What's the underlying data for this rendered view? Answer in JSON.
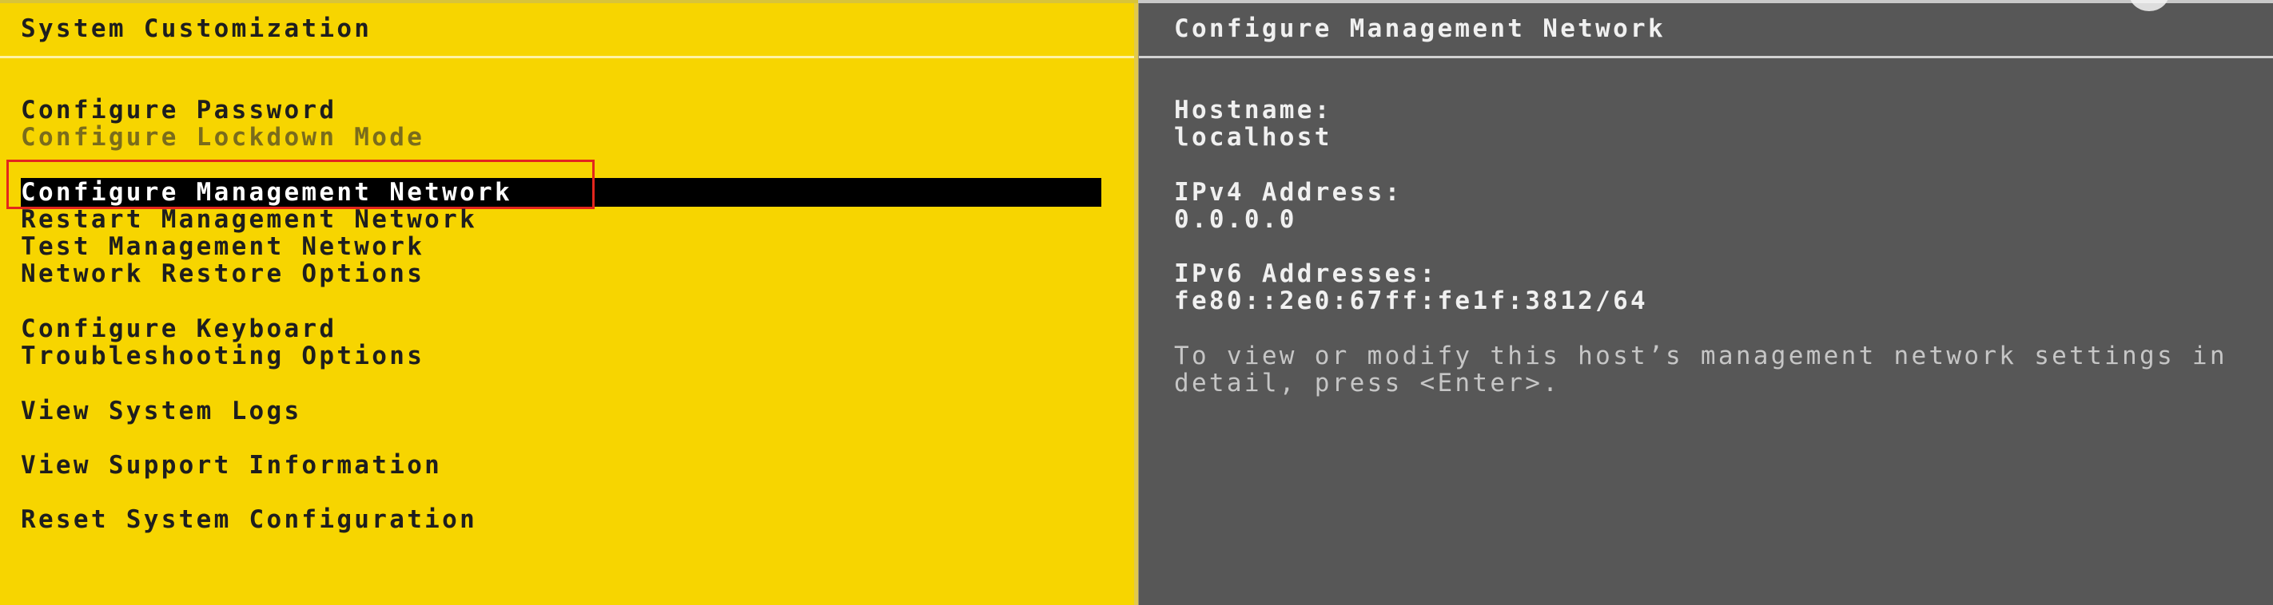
{
  "left_pane": {
    "title": "System Customization",
    "menu": [
      {
        "label": "Configure Password",
        "state": "normal"
      },
      {
        "label": "Configure Lockdown Mode",
        "state": "disabled"
      },
      {
        "label": "Configure Management Network",
        "state": "selected"
      },
      {
        "label": "Restart Management Network",
        "state": "normal"
      },
      {
        "label": "Test Management Network",
        "state": "normal"
      },
      {
        "label": "Network Restore Options",
        "state": "normal"
      },
      {
        "label": "Configure Keyboard",
        "state": "normal"
      },
      {
        "label": "Troubleshooting Options",
        "state": "normal"
      },
      {
        "label": "View System Logs",
        "state": "normal"
      },
      {
        "label": "View Support Information",
        "state": "normal"
      },
      {
        "label": "Reset System Configuration",
        "state": "normal"
      }
    ]
  },
  "right_pane": {
    "title": "Configure Management Network",
    "hostname_label": "Hostname:",
    "hostname_value": "localhost",
    "ipv4_label": "IPv4 Address:",
    "ipv4_value": "0.0.0.0",
    "ipv6_label": "IPv6 Addresses:",
    "ipv6_value": "fe80::2e0:67ff:fe1f:3812/64",
    "hint_line1": "To view or modify this host’s management network settings in",
    "hint_line2": "detail, press <Enter>."
  },
  "colors": {
    "left_background": "#f7d500",
    "right_background": "#575757",
    "selection_background": "#000000",
    "highlight_box": "#e3261d"
  }
}
